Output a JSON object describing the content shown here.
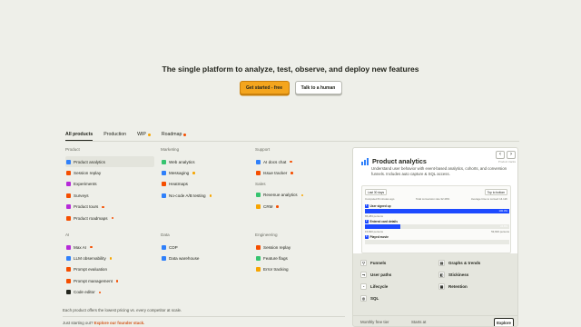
{
  "hero": {
    "title": "The single platform to analyze, test, observe, and deploy new features",
    "primary_cta": "Get started - free",
    "secondary_cta": "Talk to a human"
  },
  "tabs": [
    {
      "label": "All products",
      "active": true
    },
    {
      "label": "Production",
      "active": false
    },
    {
      "label": "WIP",
      "active": false,
      "dot_color": "#f7a501"
    },
    {
      "label": "Roadmap",
      "active": false,
      "dot_color": "#f54e00"
    }
  ],
  "columns": {
    "product": {
      "heading": "Product",
      "items": [
        {
          "label": "Product analytics",
          "icon": "bar-chart-icon",
          "color": "#2f80fa",
          "active": true
        },
        {
          "label": "Session replay",
          "icon": "replay-icon",
          "color": "#f54e00"
        },
        {
          "label": "Experiments",
          "icon": "flask-icon",
          "color": "#b62ad9"
        },
        {
          "label": "Surveys",
          "icon": "survey-icon",
          "color": "#f54e00"
        },
        {
          "label": "Product tours",
          "icon": "tour-icon",
          "color": "#b62ad9",
          "badge": "#f54e00"
        },
        {
          "label": "Product roadmaps",
          "icon": "roadmap-icon",
          "color": "#f54e00",
          "badge": "#f54e00"
        }
      ]
    },
    "ai": {
      "heading": "AI",
      "items": [
        {
          "label": "Max AI",
          "icon": "sparkle-icon",
          "color": "#b62ad9",
          "badge": "#f54e00"
        },
        {
          "label": "LLM observability",
          "icon": "llm-icon",
          "color": "#2f80fa",
          "badge": "#f7a501"
        },
        {
          "label": "Prompt evaluation",
          "icon": "check-icon",
          "color": "#f54e00"
        },
        {
          "label": "Prompt management",
          "icon": "prompt-icon",
          "color": "#f54e00",
          "badge": "#f54e00"
        },
        {
          "label": "Code editor",
          "icon": "code-icon",
          "color": "#23251d",
          "badge": "#f54e00"
        }
      ]
    },
    "marketing": {
      "heading": "Marketing",
      "items": [
        {
          "label": "Web analytics",
          "icon": "web-icon",
          "color": "#36c46f"
        },
        {
          "label": "Messaging",
          "icon": "message-icon",
          "color": "#2f80fa",
          "badge": "#f7a501"
        },
        {
          "label": "Heatmaps",
          "icon": "heatmap-icon",
          "color": "#f54e00"
        },
        {
          "label": "No-code A/B testing",
          "icon": "ab-test-icon",
          "color": "#2f80fa",
          "badge": "#f7a501"
        }
      ]
    },
    "data": {
      "heading": "Data",
      "items": [
        {
          "label": "CDP",
          "icon": "cdp-icon",
          "color": "#2f80fa"
        },
        {
          "label": "Data warehouse",
          "icon": "database-icon",
          "color": "#2f80fa"
        }
      ]
    },
    "support": {
      "heading": "Support",
      "items": [
        {
          "label": "AI docs chat",
          "icon": "chat-icon",
          "color": "#2f80fa",
          "badge": "#f54e00"
        },
        {
          "label": "Issue tracker",
          "icon": "issue-icon",
          "color": "#f54e00",
          "badge": "#f54e00"
        }
      ]
    },
    "sales": {
      "heading": "Sales",
      "items": [
        {
          "label": "Revenue analytics",
          "icon": "revenue-icon",
          "color": "#36c46f",
          "badge": "#f7a501"
        },
        {
          "label": "CRM",
          "icon": "crm-icon",
          "color": "#f7a501",
          "badge": "#f54e00"
        }
      ]
    },
    "engineering": {
      "heading": "Engineering",
      "items": [
        {
          "label": "Session replay",
          "icon": "replay-icon",
          "color": "#f54e00"
        },
        {
          "label": "Feature flags",
          "icon": "flag-icon",
          "color": "#36c46f"
        },
        {
          "label": "Error tracking",
          "icon": "error-icon",
          "color": "#f7a501"
        }
      ]
    }
  },
  "footnotes": {
    "line1": "Each product offers the lowest pricing vs. every competitor at scale.",
    "line2_prefix": "Just starting out?",
    "line2_link": "Explore our founder stack."
  },
  "panel": {
    "caption": "Product tracks",
    "title": "Product analytics",
    "description": "Understand user behavior with event-based analytics, cohorts, and conversion funnels. Includes auto capture & SQL access.",
    "mini": {
      "date_range": "Last 30 days",
      "sort": "Top to bottom",
      "stat_left": "Computed 8 minutes ago",
      "stat_mid": "Total conversion rate 32.29%",
      "stat_right": "Average time to convert 14.12h",
      "steps": [
        {
          "num": "1",
          "label": "User signed up",
          "pct": 100,
          "pct_label": "100.0%",
          "meta_left": "65,283 persons",
          "meta_right": ""
        },
        {
          "num": "2",
          "label": "Entered card details",
          "pct": 24.8,
          "pct_label": "24.8%",
          "meta_left": "15,820 persons",
          "meta_right": "53,823 persons"
        },
        {
          "num": "3",
          "label": "Played movie",
          "pct": 0,
          "pct_label": "",
          "meta_left": "",
          "meta_right": ""
        }
      ],
      "conversion_note": "Average time to convert 46.89h"
    },
    "features": [
      {
        "label": "Funnels",
        "icon": "funnel-icon"
      },
      {
        "label": "Graphs & trends",
        "icon": "graph-icon"
      },
      {
        "label": "User paths",
        "icon": "paths-icon"
      },
      {
        "label": "Stickiness",
        "icon": "stickiness-icon"
      },
      {
        "label": "Lifecycle",
        "icon": "lifecycle-icon"
      },
      {
        "label": "Retention",
        "icon": "retention-icon"
      },
      {
        "label": "SQL",
        "icon": "sql-icon"
      }
    ],
    "bottom_left": "Monthly free tier",
    "bottom_mid": "Starts at",
    "explore_label": "Explore"
  }
}
